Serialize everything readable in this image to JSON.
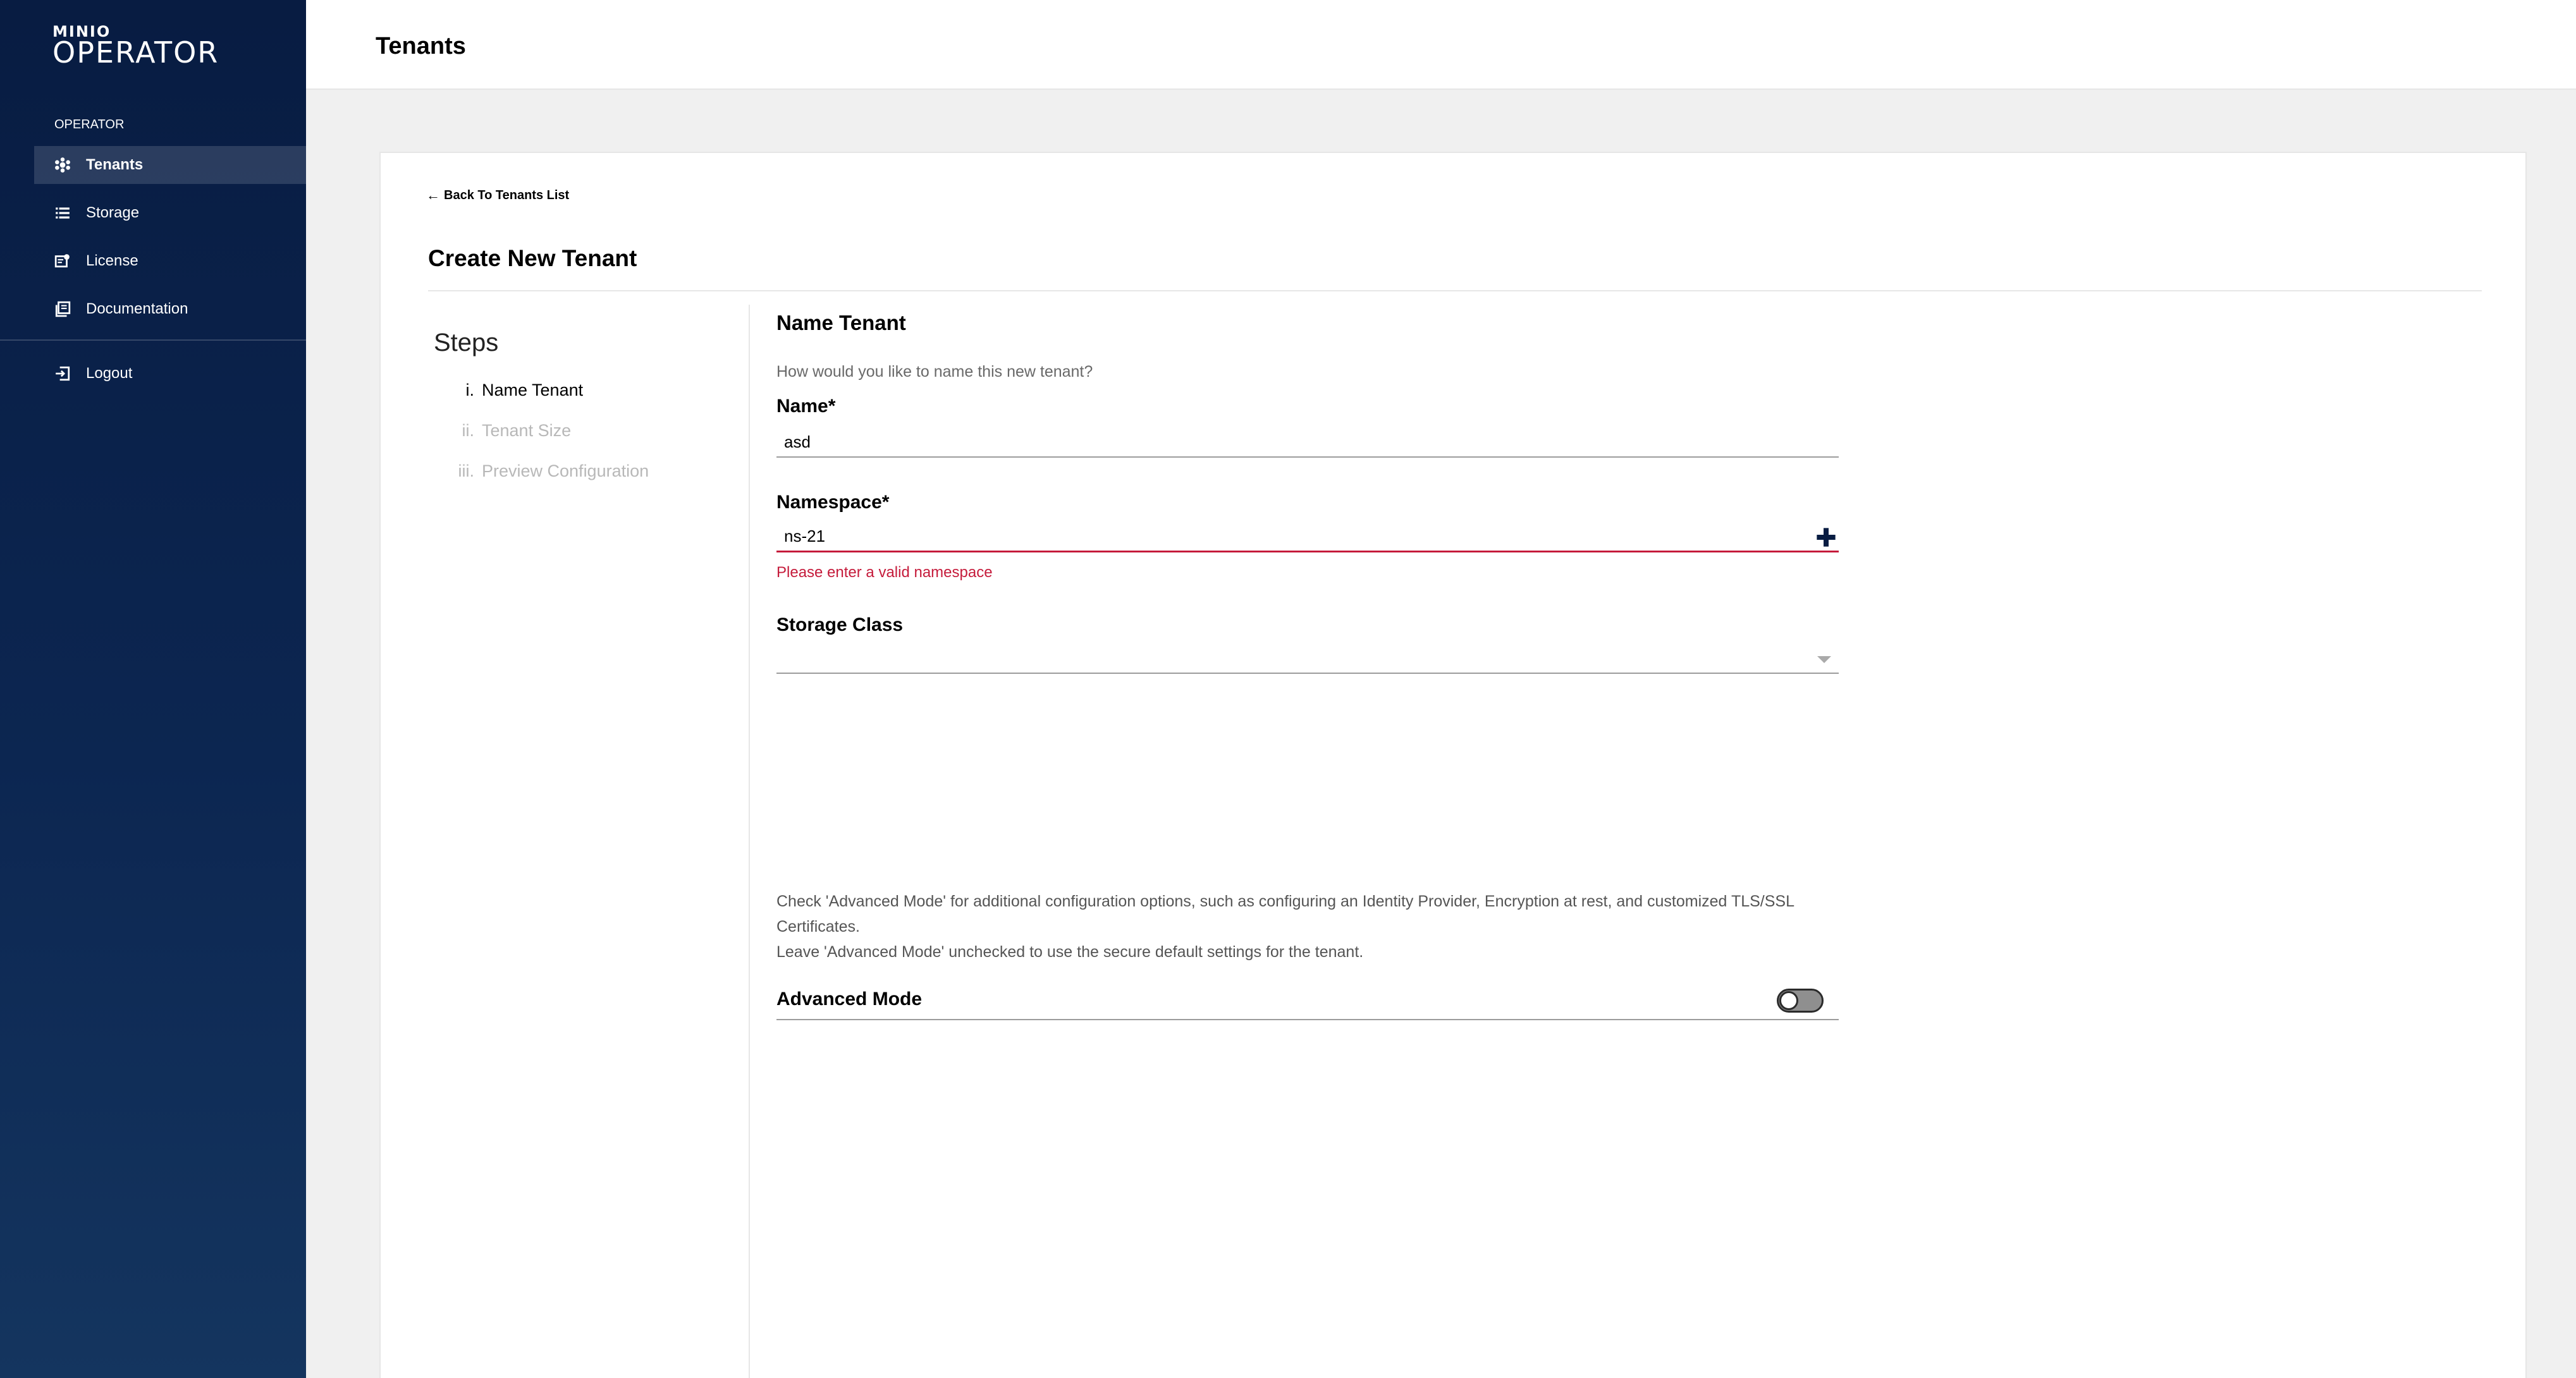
{
  "sidebar": {
    "logo_brand": "MINIO",
    "logo_product": "OPERATOR",
    "section_label": "OPERATOR",
    "items": [
      {
        "label": "Tenants",
        "icon": "tenants-icon",
        "active": true
      },
      {
        "label": "Storage",
        "icon": "storage-icon",
        "active": false
      },
      {
        "label": "License",
        "icon": "license-icon",
        "active": false
      },
      {
        "label": "Documentation",
        "icon": "documentation-icon",
        "active": false
      }
    ],
    "logout_label": "Logout"
  },
  "header": {
    "title": "Tenants"
  },
  "page": {
    "back_label": "Back To Tenants List",
    "title": "Create New Tenant"
  },
  "steps": {
    "title": "Steps",
    "items": [
      {
        "num": "i.",
        "label": "Name Tenant",
        "active": true
      },
      {
        "num": "ii.",
        "label": "Tenant Size",
        "active": false
      },
      {
        "num": "iii.",
        "label": "Preview Configuration",
        "active": false
      }
    ]
  },
  "form": {
    "title": "Name Tenant",
    "hint": "How would you like to name this new tenant?",
    "name_label": "Name*",
    "name_value": "asd",
    "namespace_label": "Namespace*",
    "namespace_value": "ns-21",
    "namespace_error": "Please enter a valid namespace",
    "storage_class_label": "Storage Class",
    "storage_class_value": "",
    "advanced_info_line1": "Check 'Advanced Mode' for additional configuration options, such as configuring an Identity Provider, Encryption at rest, and customized TLS/SSL Certificates.",
    "advanced_info_line2": "Leave 'Advanced Mode' unchecked to use the secure default settings for the tenant.",
    "advanced_mode_label": "Advanced Mode",
    "advanced_mode_enabled": false
  },
  "colors": {
    "sidebar_top": "#081c42",
    "sidebar_bottom": "#14355f",
    "error": "#c51b3b",
    "plus_icon": "#081c42"
  }
}
